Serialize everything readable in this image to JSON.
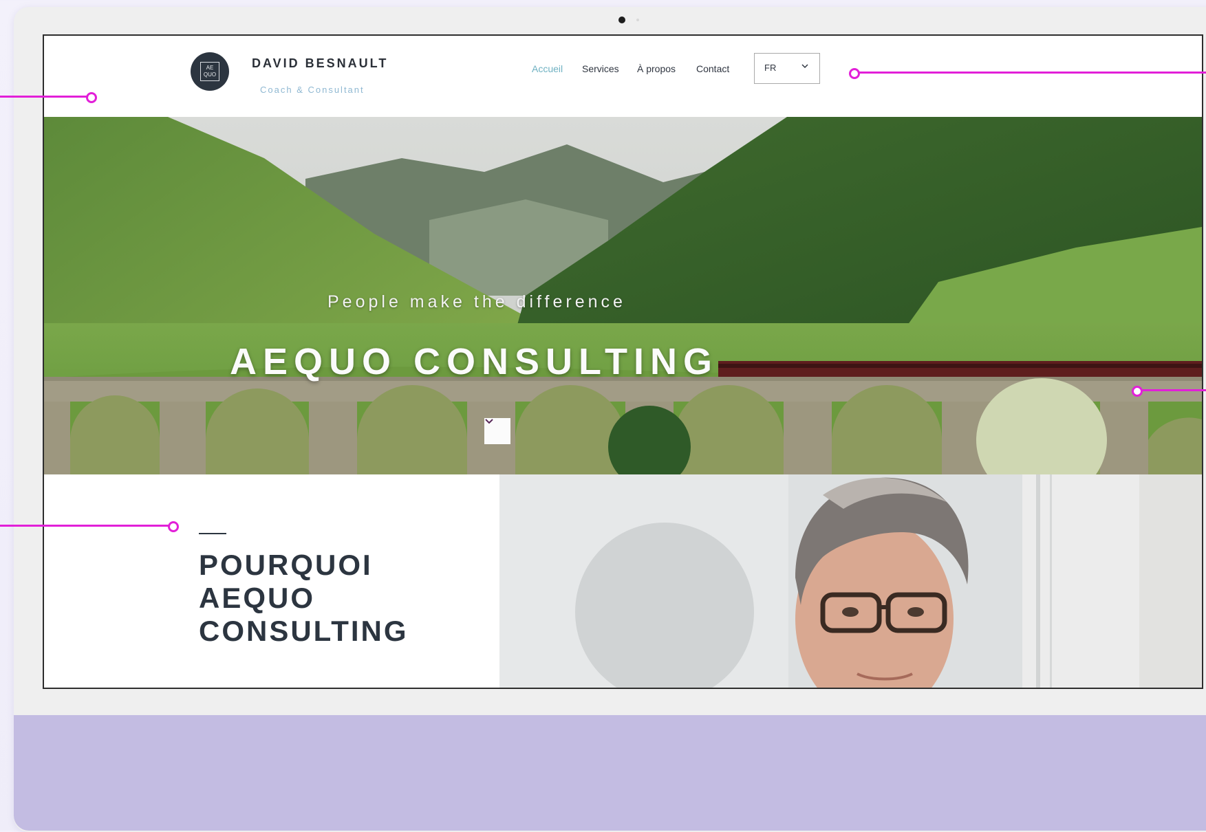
{
  "site": {
    "logo_line1": "AE",
    "logo_line2": "QUO",
    "brand_name": "DAVID BESNAULT",
    "brand_subtitle": "Coach & Consultant"
  },
  "nav": {
    "items": [
      {
        "label": "Accueil",
        "active": true
      },
      {
        "label": "Services",
        "active": false
      },
      {
        "label": "À propos",
        "active": false
      },
      {
        "label": "Contact",
        "active": false
      }
    ],
    "language": {
      "selected": "FR"
    }
  },
  "hero": {
    "tagline": "People make the difference",
    "title": "AEQUO CONSULTING"
  },
  "section": {
    "title_line1": "POURQUOI",
    "title_line2": "AEQUO",
    "title_line3": "CONSULTING"
  },
  "colors": {
    "accent": "#6fb1c2",
    "dark": "#2c3540",
    "callout": "#e21fd8",
    "chin": "#c3bce2"
  }
}
